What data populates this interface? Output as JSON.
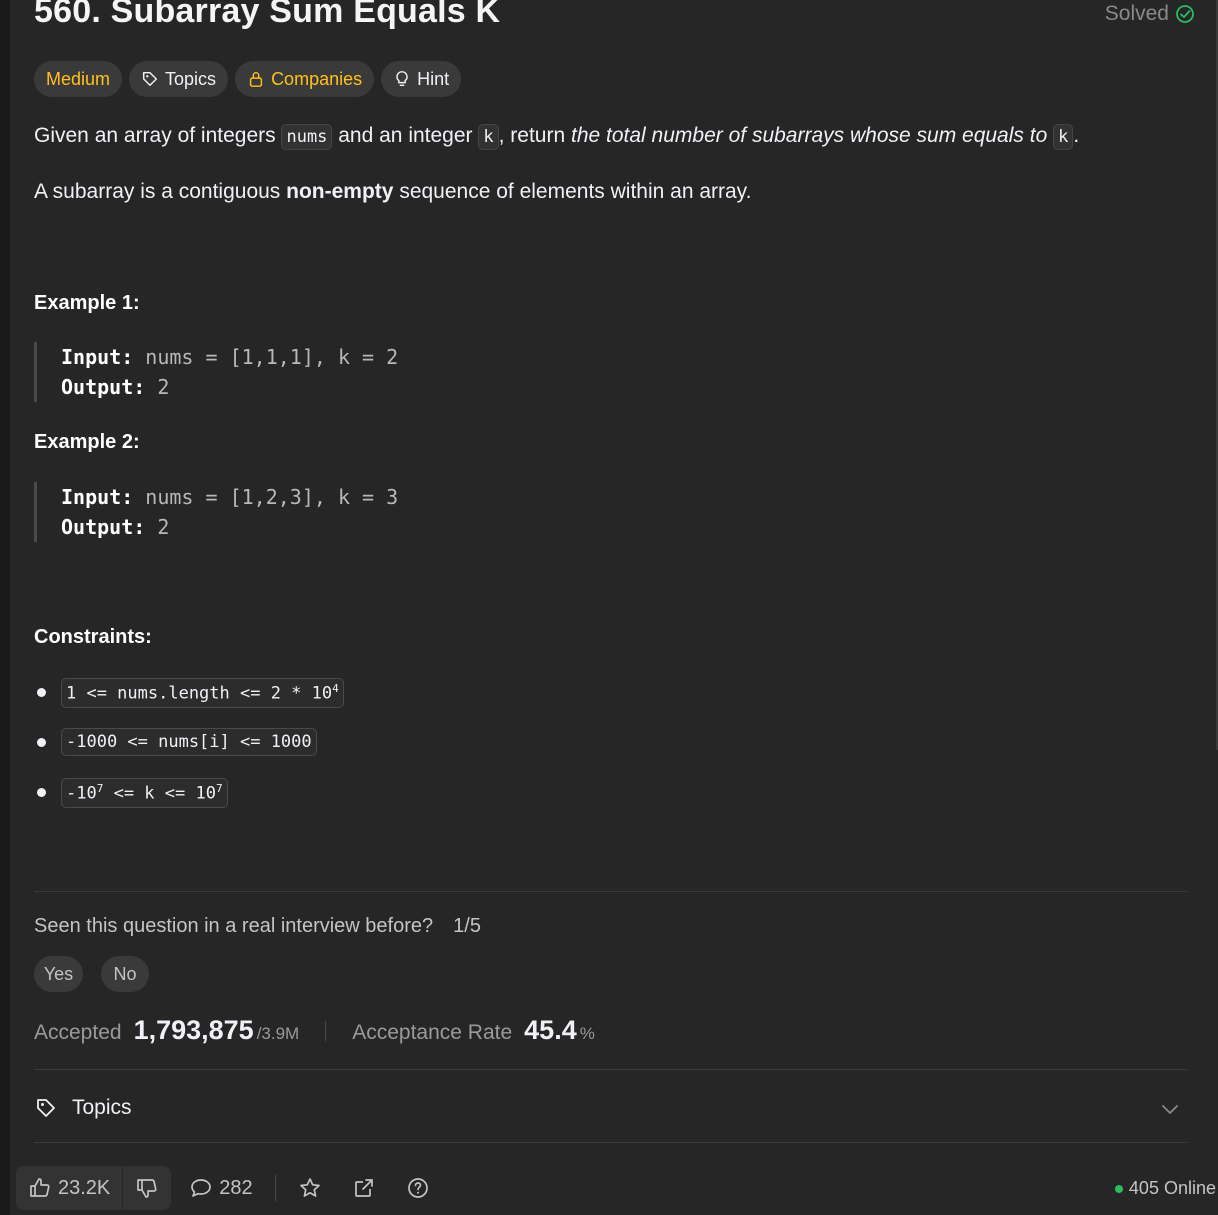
{
  "problem": {
    "title": "560. Subarray Sum Equals K",
    "status": "Solved"
  },
  "tags": {
    "difficulty": "Medium",
    "topics": "Topics",
    "companies": "Companies",
    "hint": "Hint"
  },
  "description": {
    "p1_a": "Given an array of integers ",
    "p1_code1": "nums",
    "p1_b": " and an integer ",
    "p1_code2": "k",
    "p1_c": ", return ",
    "p1_em": "the total number of subarrays whose sum equals to",
    "p1_code3": "k",
    "p1_d": ".",
    "p2_a": "A subarray is a contiguous ",
    "p2_bold": "non-empty",
    "p2_b": " sequence of elements within an array."
  },
  "examples": [
    {
      "title": "Example 1:",
      "input_label": "Input:",
      "input": "nums = [1,1,1], k = 2",
      "output_label": "Output:",
      "output": "2"
    },
    {
      "title": "Example 2:",
      "input_label": "Input:",
      "input": "nums = [1,2,3], k = 3",
      "output_label": "Output:",
      "output": "2"
    }
  ],
  "constraints": {
    "title": "Constraints:",
    "c1": "1 <= nums.length <= 2 * 10",
    "c1_sup": "4",
    "c2": "-1000 <= nums[i] <= 1000",
    "c3_a": "-10",
    "c3_sup1": "7",
    "c3_b": " <= k <= 10",
    "c3_sup2": "7"
  },
  "interview": {
    "question": "Seen this question in a real interview before?",
    "count": "1/5",
    "yes": "Yes",
    "no": "No"
  },
  "stats": {
    "accepted_label": "Accepted",
    "accepted_value": "1,793,875",
    "accepted_total": "/3.9M",
    "rate_label": "Acceptance Rate",
    "rate_value": "45.4",
    "rate_unit": "%"
  },
  "topics_section": {
    "label": "Topics"
  },
  "bottom": {
    "likes": "23.2K",
    "comments": "282",
    "online": "405 Online"
  },
  "colors": {
    "medium": "#ffc01e",
    "solved_check": "#2cbb5d",
    "online_dot": "#2cbb5d"
  }
}
